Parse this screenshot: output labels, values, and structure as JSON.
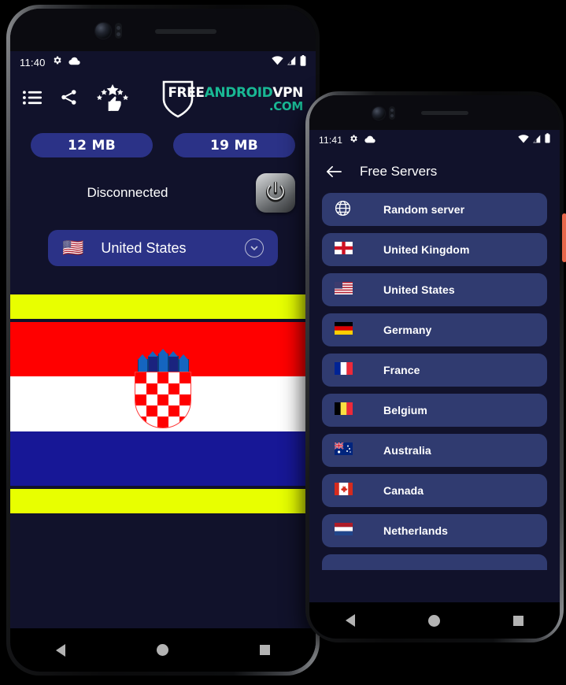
{
  "phone1": {
    "status_bar": {
      "time": "11:40",
      "icons_left": [
        "gear-icon",
        "cloud-icon"
      ],
      "icons_right": [
        "wifi-icon",
        "signal-icon",
        "battery-icon"
      ]
    },
    "toolbar": {
      "icons": [
        {
          "name": "list-menu-icon",
          "label": "Menu"
        },
        {
          "name": "share-icon",
          "label": "Share"
        },
        {
          "name": "rate-stars-thumbsup-icon",
          "label": "Rate"
        }
      ],
      "logo": {
        "part1": "FREE",
        "part2": "ANDROID",
        "part3": "VPN",
        "part4": ".COM"
      }
    },
    "stats": {
      "download": "12 MB",
      "upload": "19 MB"
    },
    "connection": {
      "status": "Disconnected",
      "power_button": "power-icon"
    },
    "selected_server": {
      "flag": "🇺🇸",
      "name": "United States",
      "chevron": "chevron-down-icon"
    },
    "banner_flag": {
      "country": "Croatia",
      "stripes": [
        "#ff0000",
        "#ffffff",
        "#171796"
      ],
      "accent_bar": "#e8ff00"
    },
    "nav": [
      "back-nav-icon",
      "home-nav-icon",
      "recents-nav-icon"
    ]
  },
  "phone2": {
    "status_bar": {
      "time": "11:41",
      "icons_left": [
        "gear-icon",
        "cloud-icon"
      ],
      "icons_right": [
        "wifi-icon",
        "signal-icon",
        "battery-icon"
      ]
    },
    "appbar": {
      "back": "arrow-back-icon",
      "title": "Free Servers"
    },
    "servers": [
      {
        "flag": "globe",
        "name": "Random server"
      },
      {
        "flag": "🏴󠁧󠁢󠁥󠁮󠁧󠁿",
        "name": "United Kingdom"
      },
      {
        "flag": "🇺🇸",
        "name": "United States"
      },
      {
        "flag": "🇩🇪",
        "name": "Germany"
      },
      {
        "flag": "🇫🇷",
        "name": "France"
      },
      {
        "flag": "🇧🇪",
        "name": "Belgium"
      },
      {
        "flag": "🇦🇺",
        "name": "Australia"
      },
      {
        "flag": "🇨🇦",
        "name": "Canada"
      },
      {
        "flag": "🇳🇱",
        "name": "Netherlands"
      }
    ],
    "nav": [
      "back-nav-icon",
      "home-nav-icon",
      "recents-nav-icon"
    ]
  },
  "colors": {
    "app_background": "#11122b",
    "pill_blue": "#2b3287",
    "list_item_blue": "#303b70",
    "brand_teal": "#19b894",
    "accent_yellow": "#e8ff00",
    "side_button_orange": "#e8674a"
  }
}
